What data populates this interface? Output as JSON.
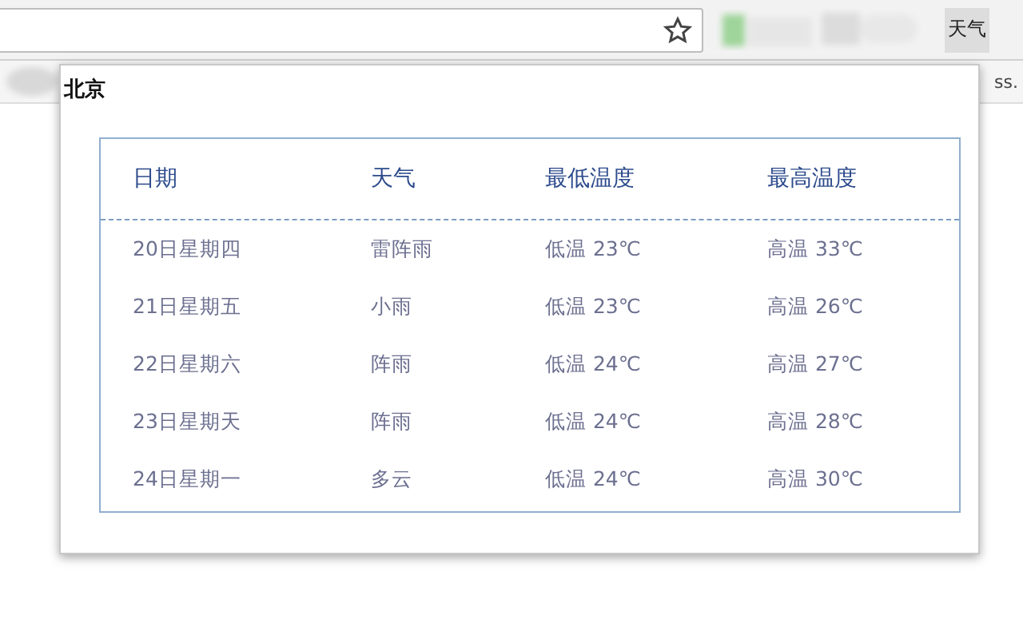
{
  "toolbar": {
    "extension_button": "天气",
    "bookmark_fragment": "ss."
  },
  "popup": {
    "title": "北京",
    "table": {
      "columns": [
        "日期",
        "天气",
        "最低温度",
        "最高温度"
      ],
      "rows": [
        [
          "20日星期四",
          "雷阵雨",
          "低温 23℃",
          "高温 33℃"
        ],
        [
          "21日星期五",
          "小雨",
          "低温 23℃",
          "高温 26℃"
        ],
        [
          "22日星期六",
          "阵雨",
          "低温 24℃",
          "高温 27℃"
        ],
        [
          "23日星期天",
          "阵雨",
          "低温 24℃",
          "高温 28℃"
        ],
        [
          "24日星期一",
          "多云",
          "低温 24℃",
          "高温 30℃"
        ]
      ]
    }
  }
}
